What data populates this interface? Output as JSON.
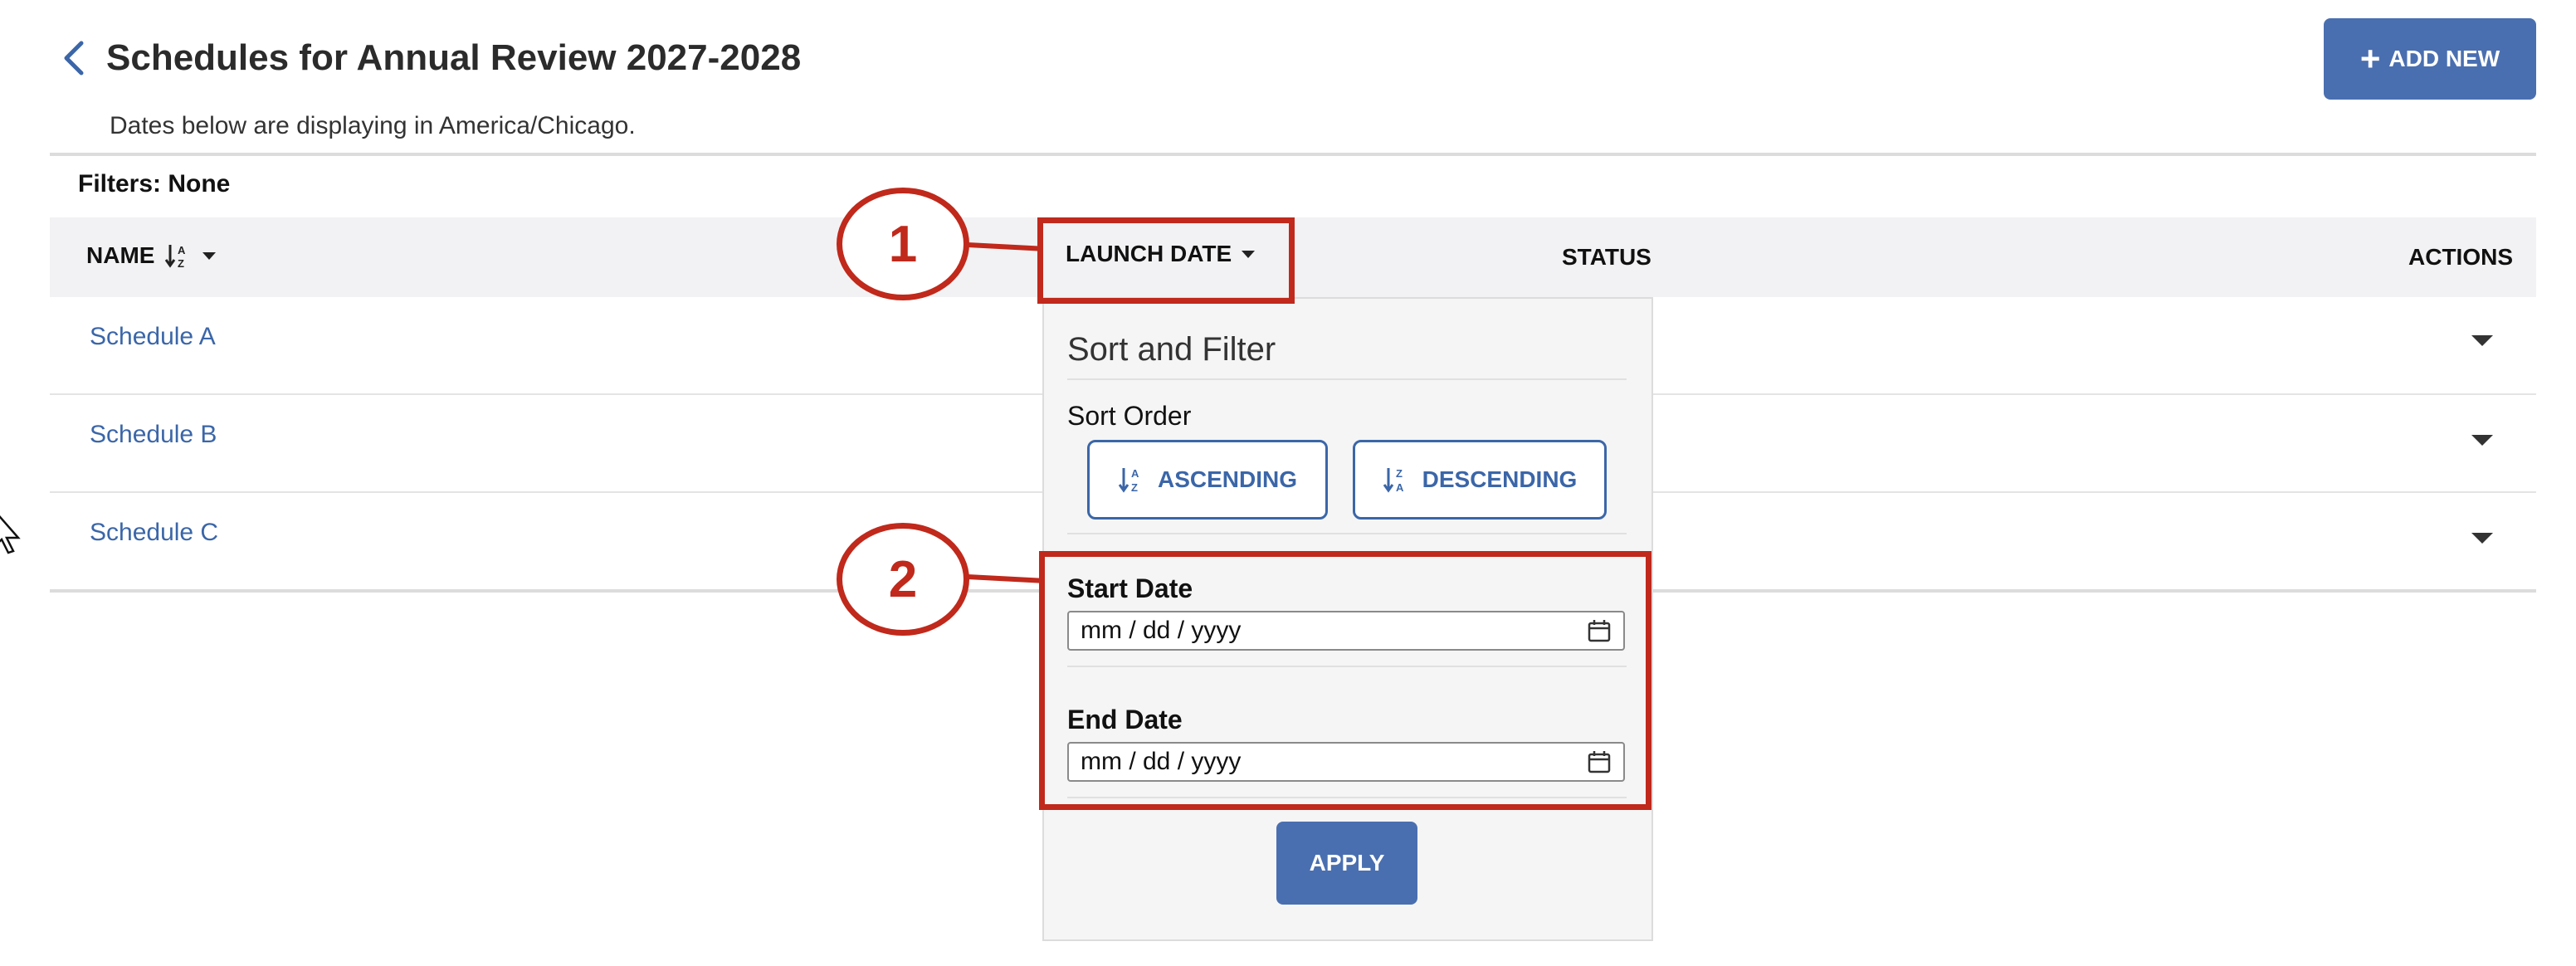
{
  "header": {
    "title": "Schedules for Annual Review 2027-2028",
    "timezone_note": "Dates below are displaying in America/Chicago.",
    "add_new_label": "ADD NEW",
    "add_new_icon": "plus-icon",
    "back_icon": "chevron-left-icon"
  },
  "filters": {
    "text": "Filters: None"
  },
  "table": {
    "columns": {
      "name": "NAME",
      "launch_date": "LAUNCH DATE",
      "status": "STATUS",
      "actions": "ACTIONS"
    },
    "name_sort_icon": "sort-alpha-asc-icon",
    "rows": [
      {
        "name": "Schedule A"
      },
      {
        "name": "Schedule B"
      },
      {
        "name": "Schedule C"
      }
    ]
  },
  "sort_filter_panel": {
    "title": "Sort and Filter",
    "sort_order_label": "Sort Order",
    "ascending_label": "ASCENDING",
    "descending_label": "DESCENDING",
    "start_date_label": "Start Date",
    "start_date_placeholder": "mm / dd / yyyy",
    "end_date_label": "End Date",
    "end_date_placeholder": "mm / dd / yyyy",
    "apply_label": "APPLY"
  },
  "annotations": {
    "callout_1": "1",
    "callout_2": "2",
    "color": "#c0291b"
  },
  "colors": {
    "primary": "#4a6fb0",
    "link": "#3b66a8",
    "header_bg": "#f2f2f4"
  }
}
